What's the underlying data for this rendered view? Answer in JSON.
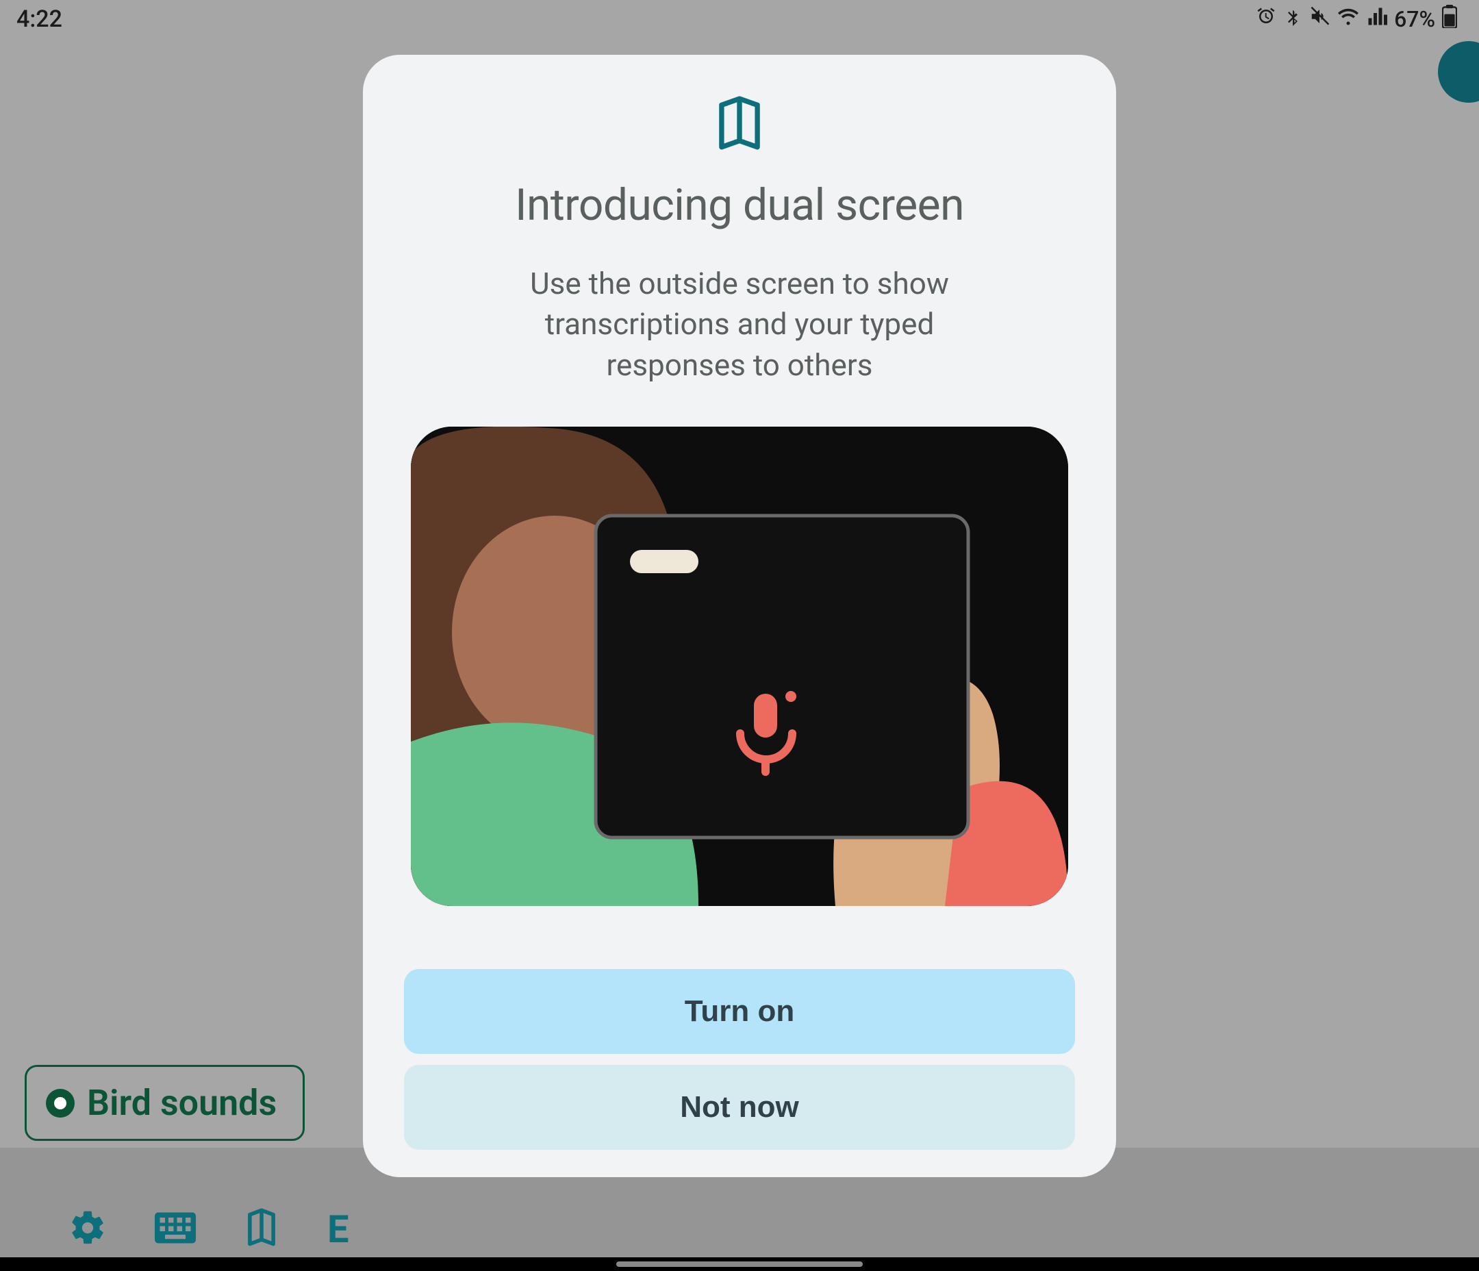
{
  "status": {
    "time": "4:22",
    "battery": "67%"
  },
  "background": {
    "chip_label": "Bird sounds",
    "bottom_letter": "E"
  },
  "modal": {
    "title": "Introducing dual screen",
    "body": "Use the outside screen to show transcriptions and your typed responses to others",
    "buttons": {
      "primary": "Turn on",
      "secondary": "Not now"
    }
  }
}
